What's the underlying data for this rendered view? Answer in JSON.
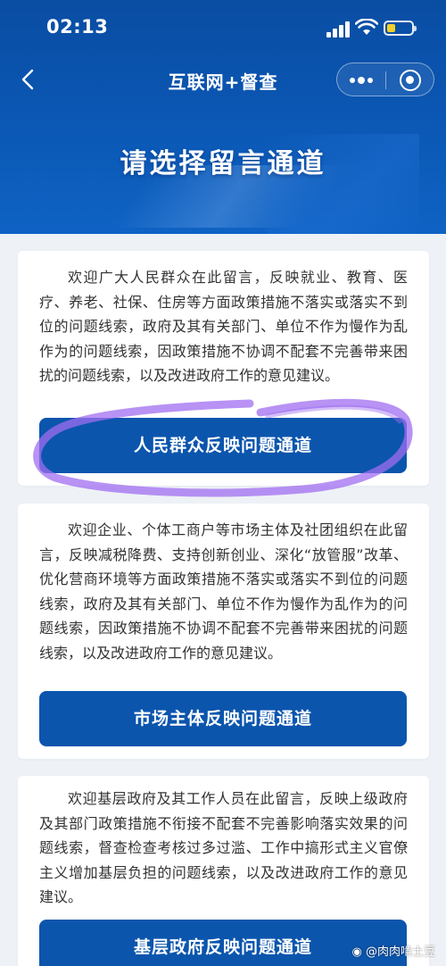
{
  "status_bar": {
    "time": "02:13"
  },
  "nav": {
    "title": "互联网+督查"
  },
  "hero": {
    "title": "请选择留言通道"
  },
  "cards": [
    {
      "text": "欢迎广大人民群众在此留言，反映就业、教育、医疗、养老、社保、住房等方面政策措施不落实或落实不到位的问题线索，政府及其有关部门、单位不作为慢作为乱作为的问题线索，因政策措施不协调不配套不完善带来困扰的问题线索，以及改进政府工作的意见建议。",
      "button": "人民群众反映问题通道"
    },
    {
      "text": "欢迎企业、个体工商户等市场主体及社团组织在此留言，反映减税降费、支持创新创业、深化“放管服”改革、优化营商环境等方面政策措施不落实或落实不到位的问题线索，政府及其有关部门、单位不作为慢作为乱作为的问题线索，因政策措施不协调不配套不完善带来困扰的问题线索，以及改进政府工作的意见建议。",
      "button": "市场主体反映问题通道"
    },
    {
      "text": "欢迎基层政府及其工作人员在此留言，反映上级政府及其部门政策措施不衔接不配套不完善影响落实效果的问题线索，督查检查考核过多过滥、工作中搞形式主义官僚主义增加基层负担的问题线索，以及改进政府工作的意见建议。",
      "button": "基层政府反映问题通道"
    }
  ],
  "watermark": "@肉肉啃土豆",
  "colors": {
    "header_blue": "#0b58b5",
    "button_blue": "#0b55ad",
    "highlight_purple": "#a06ef0",
    "battery_yellow": "#f2d028"
  },
  "icons": [
    "back-chevron-icon",
    "signal-icon",
    "wifi-icon",
    "battery-icon",
    "more-dots-icon",
    "close-target-icon",
    "weibo-icon"
  ]
}
